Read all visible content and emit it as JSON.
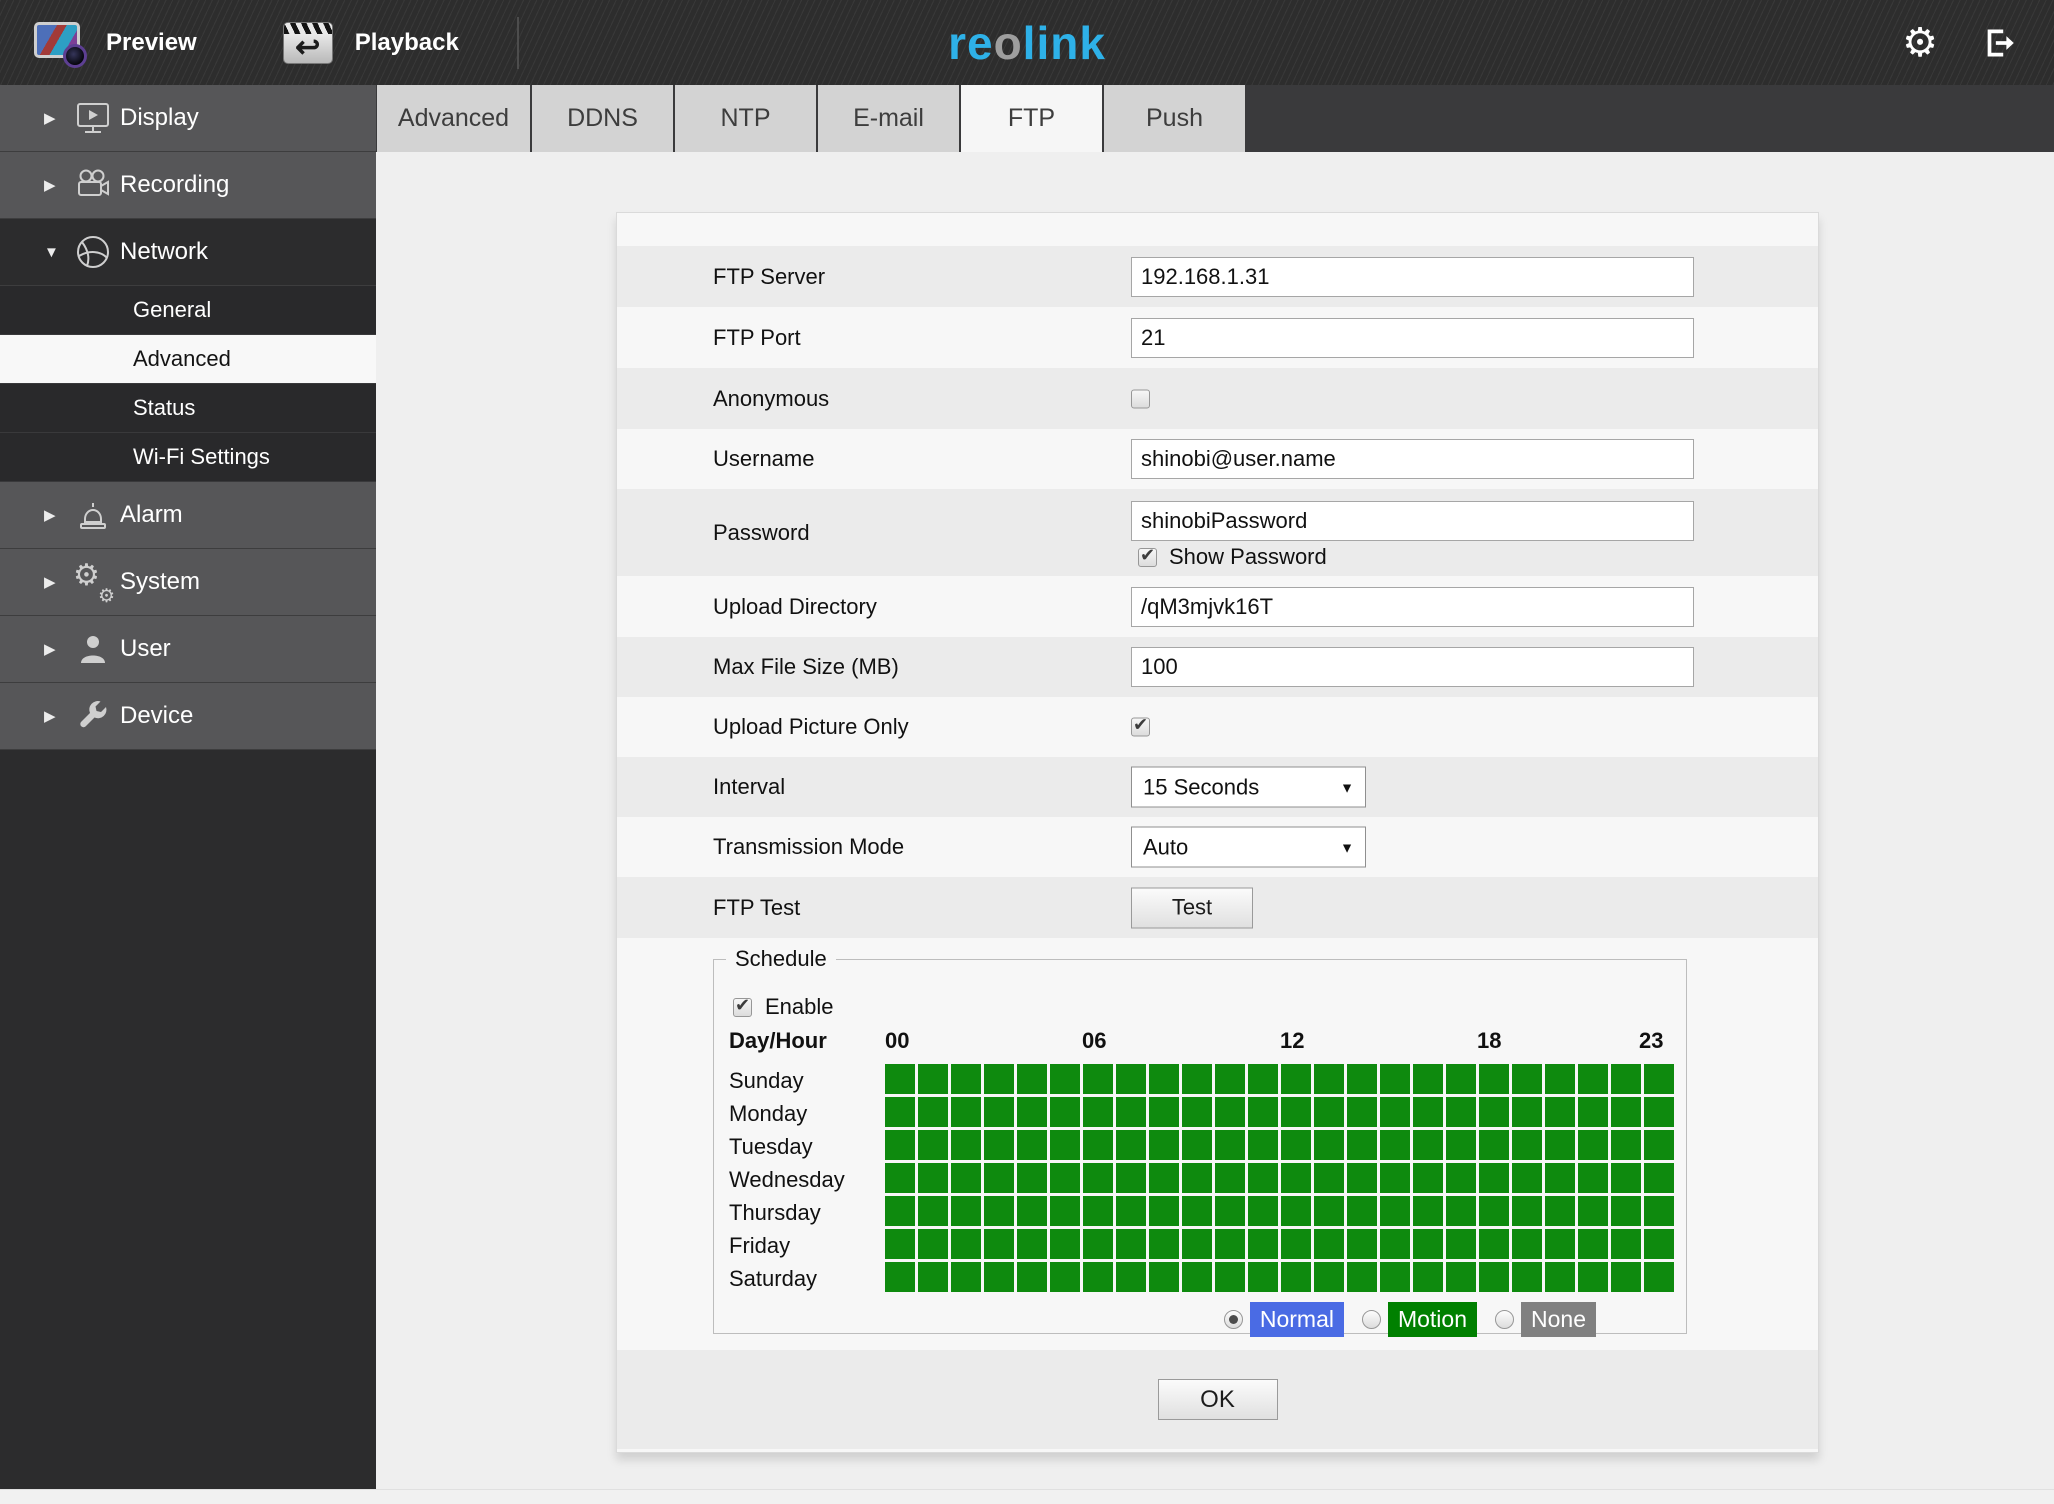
{
  "topbar": {
    "preview_label": "Preview",
    "playback_label": "Playback",
    "logo": {
      "p1": "re",
      "p2": "o",
      "p3": "link"
    }
  },
  "icons": {
    "gear_glyph": "⚙",
    "collapsed_arrow": "▶",
    "expanded_arrow": "▼",
    "check_glyph": "✔",
    "return_glyph": "↩",
    "select_arrow": "▼"
  },
  "sidebar": {
    "items": [
      {
        "label": "Display",
        "icon": "monitor-play-icon",
        "state": "collapsed"
      },
      {
        "label": "Recording",
        "icon": "camcorder-icon",
        "state": "collapsed"
      },
      {
        "label": "Network",
        "icon": "globe-icon",
        "state": "expanded"
      },
      {
        "label": "Alarm",
        "icon": "siren-icon",
        "state": "collapsed"
      },
      {
        "label": "System",
        "icon": "gears-icon",
        "state": "collapsed"
      },
      {
        "label": "User",
        "icon": "person-icon",
        "state": "collapsed"
      },
      {
        "label": "Device",
        "icon": "wrench-icon",
        "state": "collapsed"
      }
    ],
    "network_submenu": [
      {
        "label": "General",
        "active": false
      },
      {
        "label": "Advanced",
        "active": true
      },
      {
        "label": "Status",
        "active": false
      },
      {
        "label": "Wi-Fi Settings",
        "active": false
      }
    ]
  },
  "tabs": {
    "items": [
      {
        "label": "Advanced",
        "active": false
      },
      {
        "label": "DDNS",
        "active": false
      },
      {
        "label": "NTP",
        "active": false
      },
      {
        "label": "E-mail",
        "active": false
      },
      {
        "label": "FTP",
        "active": true
      },
      {
        "label": "Push",
        "active": false
      }
    ]
  },
  "form": {
    "ftp_server": {
      "label": "FTP Server",
      "value": "192.168.1.31"
    },
    "ftp_port": {
      "label": "FTP Port",
      "value": "21"
    },
    "anonymous": {
      "label": "Anonymous",
      "checked": false
    },
    "username": {
      "label": "Username",
      "value": "shinobi@user.name"
    },
    "password": {
      "label": "Password",
      "value": "shinobiPassword",
      "show_password_label": "Show Password",
      "show_password_checked": true
    },
    "upload_directory": {
      "label": "Upload Directory",
      "value": "/qM3mjvk16T"
    },
    "max_file_size": {
      "label": "Max File Size (MB)",
      "value": "100"
    },
    "upload_picture_only": {
      "label": "Upload Picture Only",
      "checked": true
    },
    "interval": {
      "label": "Interval",
      "value": "15 Seconds"
    },
    "transmission_mode": {
      "label": "Transmission Mode",
      "value": "Auto"
    },
    "ftp_test": {
      "label": "FTP Test",
      "button_label": "Test"
    }
  },
  "schedule": {
    "legend": "Schedule",
    "enable_label": "Enable",
    "enable_checked": true,
    "day_hour_label": "Day/Hour",
    "hour_labels": [
      "00",
      "06",
      "12",
      "18",
      "23"
    ],
    "days": [
      "Sunday",
      "Monday",
      "Tuesday",
      "Wednesday",
      "Thursday",
      "Friday",
      "Saturday"
    ],
    "grid": {
      "columns": 24,
      "rows": 7,
      "cell_state_all": "on",
      "cell_color": "#0e8a0e"
    },
    "modes": [
      {
        "label": "Normal",
        "color": "#4a6be4",
        "selected": true
      },
      {
        "label": "Motion",
        "color": "#008000",
        "selected": false
      },
      {
        "label": "None",
        "color": "#808080",
        "selected": false
      }
    ]
  },
  "ok_button_label": "OK",
  "colors": {
    "logo_cyan": "#2eb1e8",
    "logo_gray": "#9e9e9e",
    "grid_green": "#0e8a0e",
    "normal_blue": "#4a6be4",
    "motion_green": "#008000",
    "none_gray": "#808080",
    "topbar_bg": "#2d2d2d",
    "sidebar_item_bg": "#565658",
    "active_tab_bg": "#f6f6f6",
    "row_gray": "#ebebeb"
  }
}
